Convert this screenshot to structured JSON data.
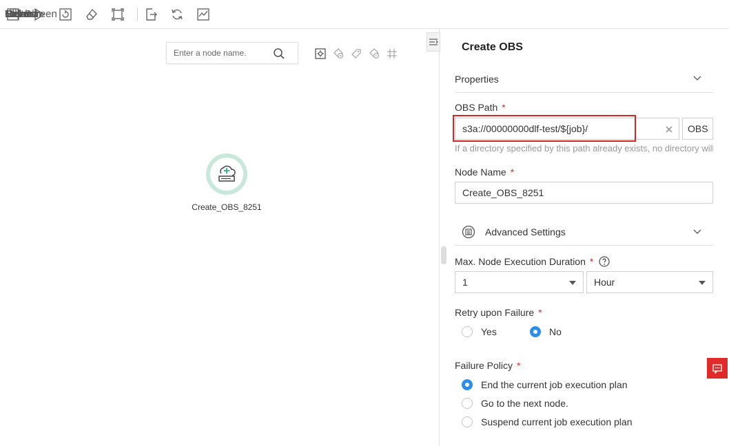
{
  "toolbar": {
    "save": "Save",
    "test": "Test",
    "submit": "Submit",
    "clear": "Clear",
    "full_screen": "Full Screen",
    "export": "Export",
    "refresh": "Refresh",
    "monitor": "Monitor"
  },
  "canvas": {
    "search_placeholder": "Enter a node name.",
    "node_label": "Create_OBS_8251"
  },
  "panel": {
    "title": "Create OBS",
    "properties": "Properties",
    "obs_path_label": "OBS Path",
    "obs_path_value": "s3a://00000000dlf-test/${job}/",
    "obs_button": "OBS",
    "obs_hint": "If a directory specified by this path already exists, no directory will be created.",
    "node_name_label": "Node Name",
    "node_name_value": "Create_OBS_8251",
    "advanced_settings": "Advanced Settings",
    "max_duration_label": "Max. Node Execution Duration",
    "max_duration_value": "1",
    "max_duration_unit": "Hour",
    "retry_label": "Retry upon Failure",
    "retry_yes": "Yes",
    "retry_no": "No",
    "failure_policy_label": "Failure Policy",
    "policy_end": "End the current job execution plan",
    "policy_next": "Go to the next node.",
    "policy_suspend": "Suspend current job execution plan",
    "required_mark": "*"
  },
  "colors": {
    "accent": "#2a8df0",
    "required": "#e02b2b",
    "highlight": "#d9241f",
    "node_ring": "#c9e8dc"
  }
}
